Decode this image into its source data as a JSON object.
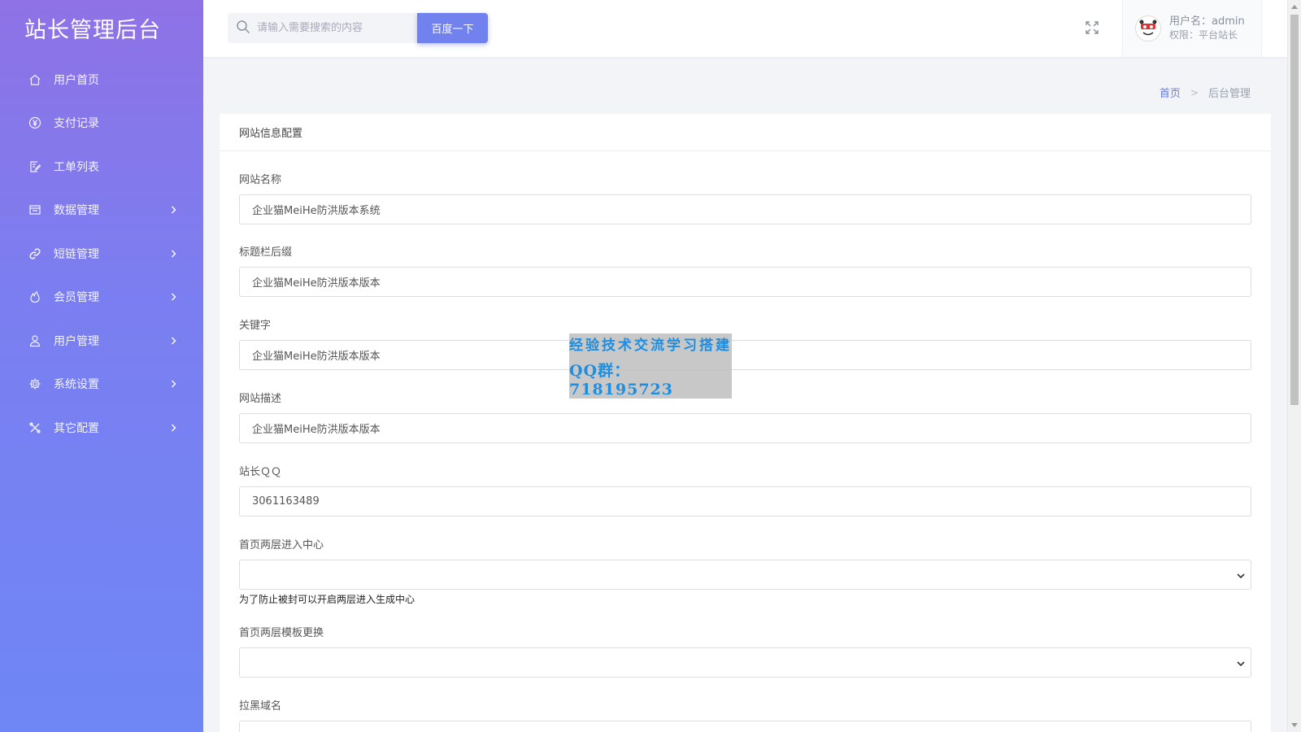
{
  "brand": "站长管理后台",
  "menu": [
    {
      "label": "用户首页",
      "icon": "home-icon",
      "has_submenu": false
    },
    {
      "label": "支付记录",
      "icon": "yuan-icon",
      "has_submenu": false
    },
    {
      "label": "工单列表",
      "icon": "edit-doc-icon",
      "has_submenu": false
    },
    {
      "label": "数据管理",
      "icon": "window-icon",
      "has_submenu": true
    },
    {
      "label": "短链管理",
      "icon": "link-icon",
      "has_submenu": true
    },
    {
      "label": "会员管理",
      "icon": "flame-icon",
      "has_submenu": true
    },
    {
      "label": "用户管理",
      "icon": "user-icon",
      "has_submenu": true
    },
    {
      "label": "系统设置",
      "icon": "gear-icon",
      "has_submenu": true
    },
    {
      "label": "其它配置",
      "icon": "tools-icon",
      "has_submenu": true
    }
  ],
  "search": {
    "placeholder": "请输入需要搜索的内容",
    "button": "百度一下"
  },
  "user": {
    "name": "用户名：admin",
    "role": "权限：平台站长"
  },
  "breadcrumb": {
    "home": "首页",
    "separator": ">",
    "current": "后台管理"
  },
  "card": {
    "title": "网站信息配置",
    "fields": {
      "site_name": {
        "label": "网站名称",
        "value": "企业猫MeiHe防洪版本系统"
      },
      "title_suffix": {
        "label": "标题栏后缀",
        "value": "企业猫MeiHe防洪版本版本"
      },
      "keywords": {
        "label": "关键字",
        "value": "企业猫MeiHe防洪版本版本"
      },
      "description": {
        "label": "网站描述",
        "value": "企业猫MeiHe防洪版本版本"
      },
      "qq": {
        "label": "站长ＱＱ",
        "value": "3061163489"
      },
      "two_layer": {
        "label": "首页两层进入中心",
        "value": "",
        "help": "为了防止被封可以开启两层进入生成中心"
      },
      "template": {
        "label": "首页两层模板更换",
        "value": ""
      },
      "blacklist": {
        "label": "拉黑域名"
      }
    }
  },
  "watermark": {
    "line1": "经验技术交流学习搭建",
    "line2": "QQ群：718195723"
  },
  "colors": {
    "sidebar_top": "#8e72e6",
    "sidebar_bottom": "#6f86f5",
    "accent": "#7181ee",
    "watermark_text": "#1e8ee0"
  }
}
